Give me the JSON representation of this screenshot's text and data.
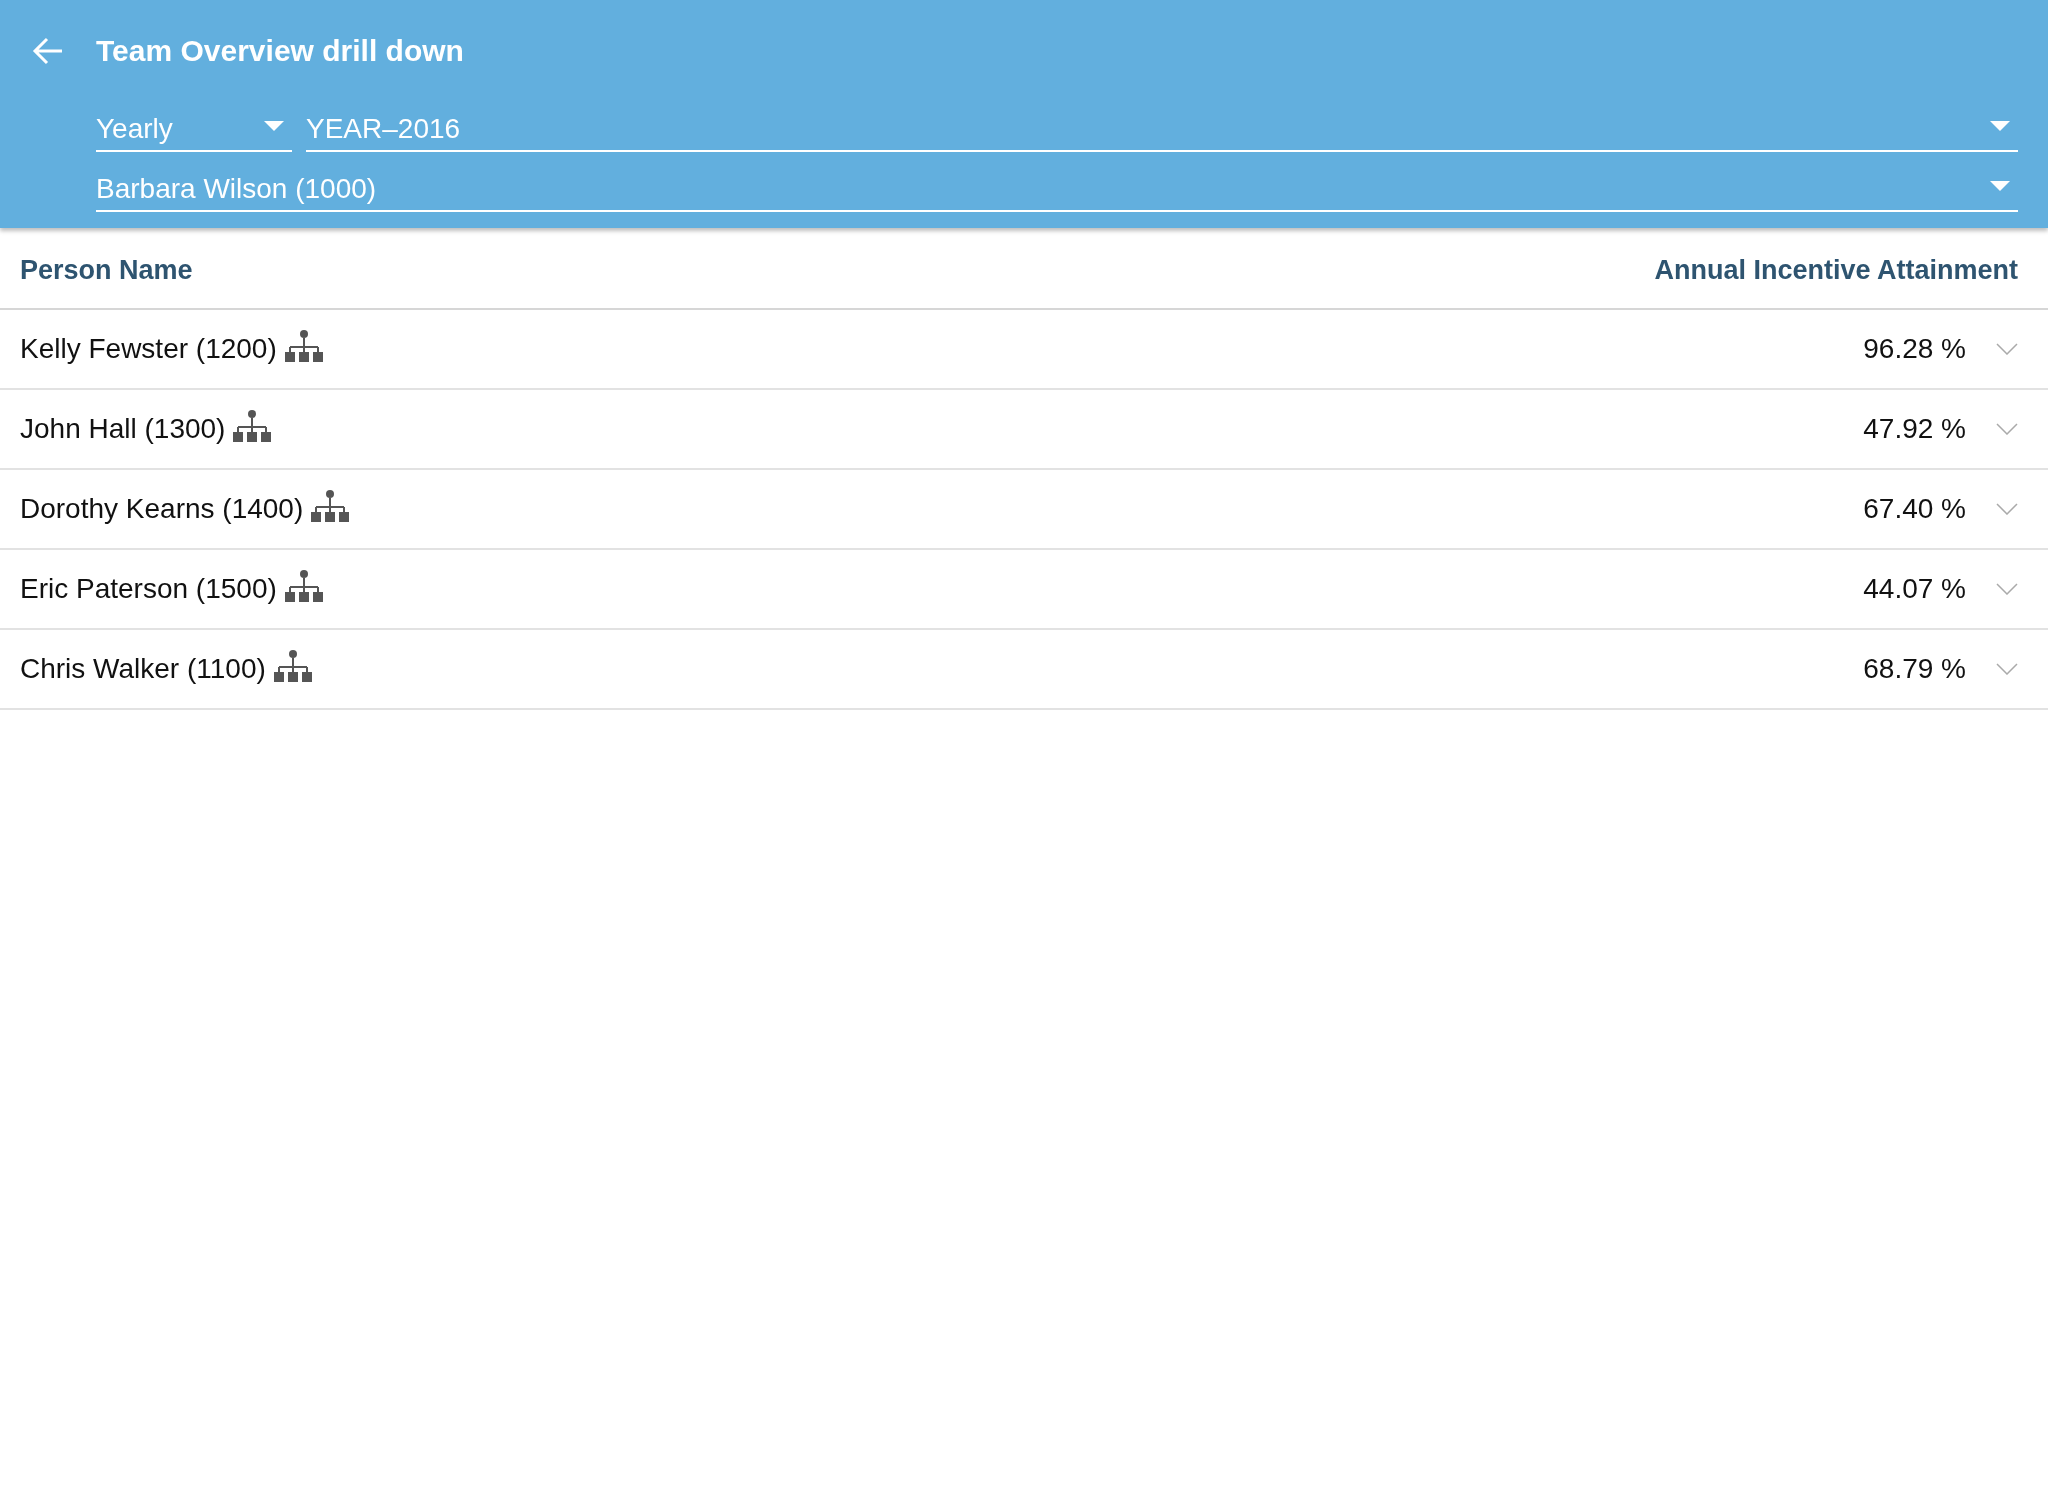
{
  "header": {
    "title": "Team Overview drill down",
    "period_type": {
      "value": "Yearly"
    },
    "period": {
      "value": "YEAR–2016"
    },
    "person": {
      "value": "Barbara Wilson (1000)"
    }
  },
  "table": {
    "columns": [
      "Person Name",
      "Annual Incentive Attainment"
    ],
    "rows": [
      {
        "name": "Kelly Fewster (1200)",
        "attainment": "96.28 %"
      },
      {
        "name": "John Hall (1300)",
        "attainment": "47.92 %"
      },
      {
        "name": "Dorothy Kearns (1400)",
        "attainment": "67.40 %"
      },
      {
        "name": "Eric Paterson (1500)",
        "attainment": "44.07 %"
      },
      {
        "name": "Chris Walker (1100)",
        "attainment": "68.79 %"
      }
    ]
  }
}
